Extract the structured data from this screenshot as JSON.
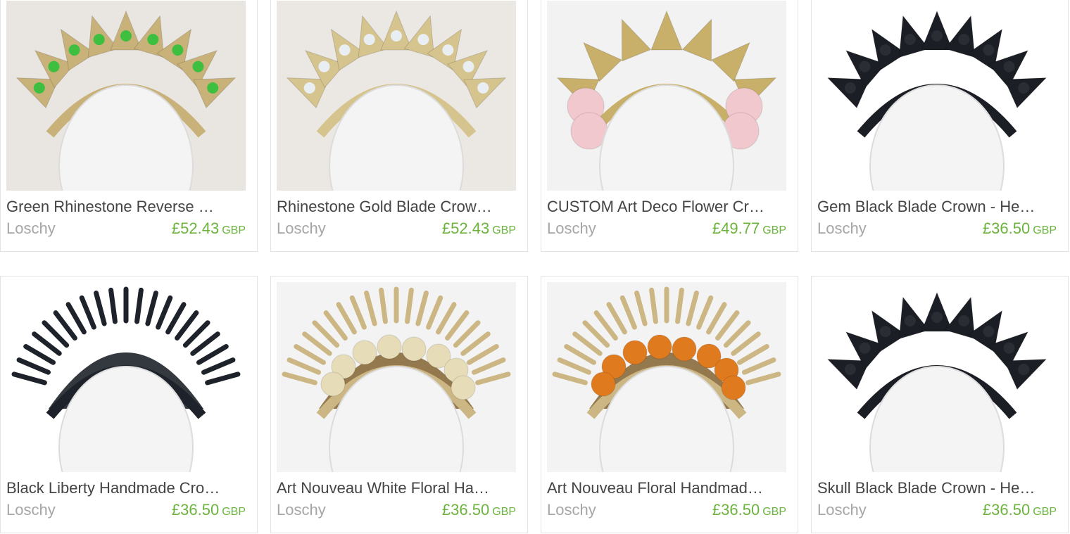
{
  "listings": [
    {
      "title": "Green Rhinestone Reverse …",
      "shop": "Loschy",
      "price": "£52.43",
      "currency": "GBP",
      "image_icon": "green-rhinestone-crown-image",
      "bg": "#e9e6e1",
      "crown": "#c9b27a",
      "gem": "#3fbf3f",
      "style": "gem"
    },
    {
      "title": "Rhinestone Gold Blade Crow…",
      "shop": "Loschy",
      "price": "£52.43",
      "currency": "GBP",
      "image_icon": "rhinestone-gold-crown-image",
      "bg": "#ebe8e3",
      "crown": "#d6c48e",
      "gem": "#e8eef2",
      "style": "gem"
    },
    {
      "title": "CUSTOM Art Deco Flower Cr…",
      "shop": "Loschy",
      "price": "£49.77",
      "currency": "GBP",
      "image_icon": "art-deco-flower-crown-image",
      "bg": "#f2f2f2",
      "crown": "#c9b06a",
      "gem": "#f2c8cf",
      "style": "deco"
    },
    {
      "title": "Gem Black Blade Crown - He…",
      "shop": "Loschy",
      "price": "£36.50",
      "currency": "GBP",
      "image_icon": "gem-black-crown-image",
      "bg": "#ffffff",
      "crown": "#1b1e24",
      "gem": "#2a2d33",
      "style": "spike"
    },
    {
      "title": "Black Liberty Handmade Cro…",
      "shop": "Loschy",
      "price": "£36.50",
      "currency": "GBP",
      "image_icon": "black-liberty-crown-image",
      "bg": "#ffffff",
      "crown": "#1e222a",
      "gem": "#30343c",
      "style": "rays"
    },
    {
      "title": "Art Nouveau White Floral Ha…",
      "shop": "Loschy",
      "price": "£36.50",
      "currency": "GBP",
      "image_icon": "art-nouveau-white-floral-image",
      "bg": "#f3f3f3",
      "crown": "#cbb684",
      "gem": "#e6dcb8",
      "style": "floral"
    },
    {
      "title": "Art Nouveau Floral Handmad…",
      "shop": "Loschy",
      "price": "£36.50",
      "currency": "GBP",
      "image_icon": "art-nouveau-floral-image",
      "bg": "#f3f3f3",
      "crown": "#cbb684",
      "gem": "#e07a1f",
      "style": "floral"
    },
    {
      "title": "Skull Black Blade Crown - He…",
      "shop": "Loschy",
      "price": "£36.50",
      "currency": "GBP",
      "image_icon": "skull-black-crown-image",
      "bg": "#ffffff",
      "crown": "#1b1e24",
      "gem": "#2a2d33",
      "style": "spike"
    }
  ]
}
